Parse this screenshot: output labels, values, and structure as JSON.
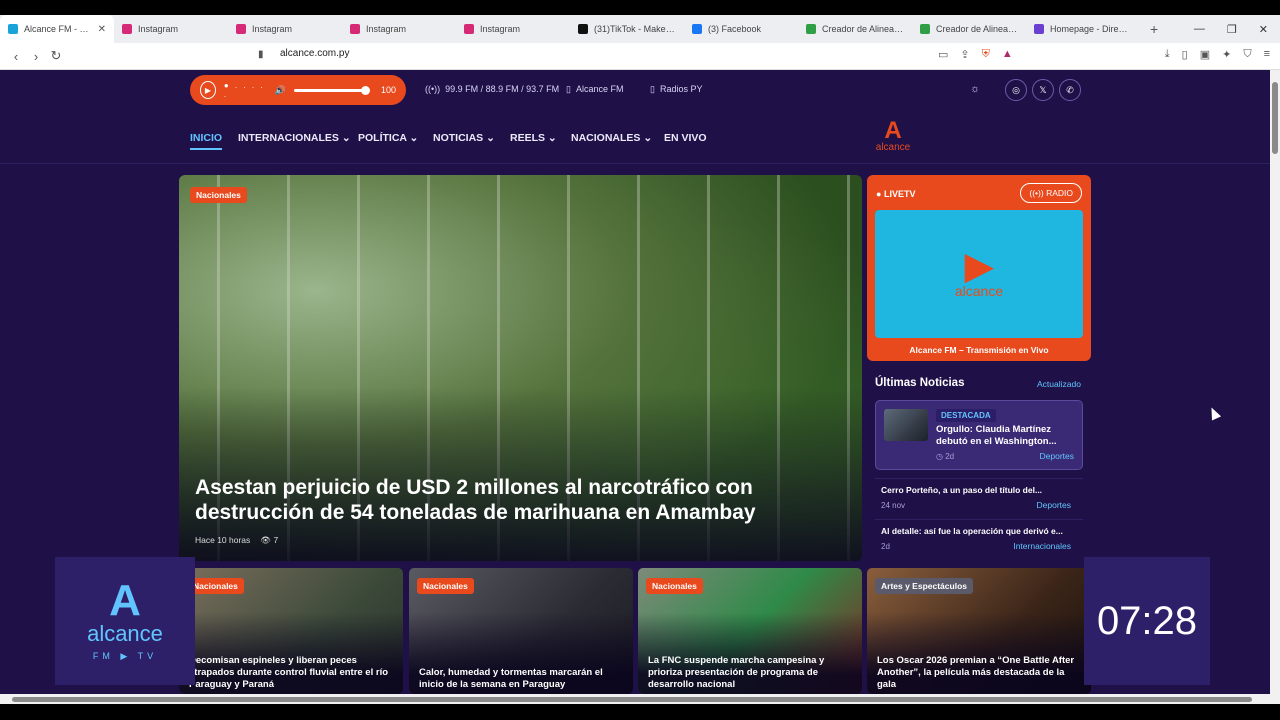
{
  "browser": {
    "tabs": [
      {
        "label": "Alcance FM - Bue",
        "color": "#1aa3d9"
      },
      {
        "label": "Instagram",
        "color": "#d62976"
      },
      {
        "label": "Instagram",
        "color": "#d62976"
      },
      {
        "label": "Instagram",
        "color": "#d62976"
      },
      {
        "label": "Instagram",
        "color": "#d62976"
      },
      {
        "label": "(31)TikTok - Make You",
        "color": "#111111"
      },
      {
        "label": "(3) Facebook",
        "color": "#1877f2"
      },
      {
        "label": "Creador de Alineacio",
        "color": "#2f9e44"
      },
      {
        "label": "Creador de Alineacio",
        "color": "#2f9e44"
      },
      {
        "label": "Homepage - Dirección",
        "color": "#6a3fd1"
      }
    ],
    "url": "alcance.com.py"
  },
  "player": {
    "volume": "100"
  },
  "frequencies": "99.9 FM / 88.9 FM / 93.7 FM",
  "top_links": {
    "alcance_fm": "Alcance FM",
    "radios_py": "Radios PY"
  },
  "nav": [
    "INICIO",
    "INTERNACIONALES ⌄",
    "POLÍTICA ⌄",
    "NOTICIAS ⌄",
    "REELS ⌄",
    "NACIONALES ⌄",
    "EN VIVO"
  ],
  "logo": {
    "mark": "A",
    "text": "alcance"
  },
  "hero": {
    "category": "Nacionales",
    "title": "Asestan perjuicio de USD 2 millones al narcotráfico con destrucción de 54 toneladas de marihuana en Amambay",
    "time": "Hace 10 horas",
    "views": "7"
  },
  "live": {
    "label": "LIVETV",
    "radio_button": "RADIO",
    "caption": "Alcance FM – Transmisión en Vivo"
  },
  "latest": {
    "heading": "Últimas Noticias",
    "updated": "Actualizado",
    "featured": {
      "tag": "DESTACADA",
      "title": "Orgullo: Claudia Martínez debutó en el Washington...",
      "age": "2d",
      "category": "Deportes"
    },
    "items": [
      {
        "title": "Cerro Porteño, a un paso del título del...",
        "date": "24 nov",
        "category": "Deportes"
      },
      {
        "title": "Al detalle: así fue la operación que derivó e...",
        "date": "2d",
        "category": "Internacionales"
      }
    ]
  },
  "cards": [
    {
      "category": "Nacionales",
      "title": "Decomisan espineles y liberan peces atrapados durante control fluvial entre el río Paraguay y Paraná"
    },
    {
      "category": "Nacionales",
      "title": "Calor, humedad y tormentas marcarán el inicio de la semana en Paraguay"
    },
    {
      "category": "Nacionales",
      "title": "La FNC suspende marcha campesina y prioriza presentación de programa de desarrollo nacional"
    },
    {
      "category": "Artes y Espectáculos",
      "title": "Los Oscar 2026 premian a “One Battle After Another”, la película más destacada de la gala"
    }
  ],
  "overlay": {
    "logo_text": "alcance",
    "logo_sub": "FM ▶ TV",
    "clock": "07:28"
  }
}
